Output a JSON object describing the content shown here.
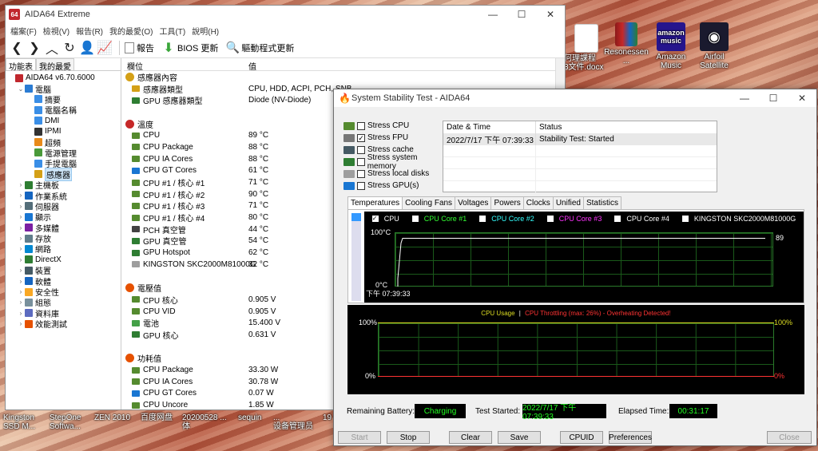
{
  "desktop": {
    "icons": [
      {
        "label": "何理課程\n3文件.docx",
        "color": "#2b579a"
      },
      {
        "label": "Resonessen\n...",
        "color": "#8b1a1a"
      },
      {
        "label": "Amazon\nMusic",
        "color": "#25158d"
      },
      {
        "label": "Airfoil\nSatellite",
        "color": "#1a1a2e"
      }
    ],
    "taskbar_items": [
      "Kingston\nSSD M...",
      "StepOne\nSoftwa...",
      "ZEN 2010",
      "百度网盘",
      "20200528 ...\n体",
      "sequin",
      "...\n设备管理员",
      "19"
    ]
  },
  "aida": {
    "title": "AIDA64 Extreme",
    "logo": "64",
    "menu": [
      "檔案(F)",
      "檢視(V)",
      "報告(R)",
      "我的最愛(O)",
      "工具(T)",
      "說明(H)"
    ],
    "toolbar": {
      "report": "報告",
      "bios": "BIOS 更新",
      "driver": "驅動程式更新"
    },
    "tabs": [
      "功能表",
      "我的最愛"
    ],
    "tree": [
      {
        "label": "AIDA64 v6.70.6000",
        "tog": "",
        "color": "#c0272d",
        "indent": 0
      },
      {
        "label": "電腦",
        "tog": "v",
        "color": "#2b7cd3",
        "indent": 1
      },
      {
        "label": "摘要",
        "tog": "",
        "color": "#3a8ee6",
        "indent": 2
      },
      {
        "label": "電腦名稱",
        "tog": "",
        "color": "#3a8ee6",
        "indent": 2
      },
      {
        "label": "DMI",
        "tog": "",
        "color": "#3a8ee6",
        "indent": 2
      },
      {
        "label": "IPMI",
        "tog": "",
        "color": "#333",
        "indent": 2
      },
      {
        "label": "超頻",
        "tog": "",
        "color": "#e88a1a",
        "indent": 2
      },
      {
        "label": "電源管理",
        "tog": "",
        "color": "#4a9a3a",
        "indent": 2
      },
      {
        "label": "手提電腦",
        "tog": "",
        "color": "#3a8ee6",
        "indent": 2
      },
      {
        "label": "感應器",
        "tog": "",
        "color": "#d4a017",
        "indent": 2,
        "selected": true
      },
      {
        "label": "主機板",
        "tog": ">",
        "color": "#2e7d32",
        "indent": 1
      },
      {
        "label": "作業系統",
        "tog": ">",
        "color": "#1565c0",
        "indent": 1
      },
      {
        "label": "伺服器",
        "tog": ">",
        "color": "#546e7a",
        "indent": 1
      },
      {
        "label": "顯示",
        "tog": ">",
        "color": "#1976d2",
        "indent": 1
      },
      {
        "label": "多媒體",
        "tog": ">",
        "color": "#7b1fa2",
        "indent": 1
      },
      {
        "label": "存放",
        "tog": ">",
        "color": "#607d8b",
        "indent": 1
      },
      {
        "label": "網路",
        "tog": ">",
        "color": "#0288d1",
        "indent": 1
      },
      {
        "label": "DirectX",
        "tog": ">",
        "color": "#2e7d32",
        "indent": 1
      },
      {
        "label": "裝置",
        "tog": ">",
        "color": "#455a64",
        "indent": 1
      },
      {
        "label": "軟體",
        "tog": ">",
        "color": "#1565c0",
        "indent": 1
      },
      {
        "label": "安全性",
        "tog": ">",
        "color": "#f9a825",
        "indent": 1
      },
      {
        "label": "組態",
        "tog": ">",
        "color": "#78909c",
        "indent": 1
      },
      {
        "label": "資料庫",
        "tog": ">",
        "color": "#5c6bc0",
        "indent": 1
      },
      {
        "label": "效能測試",
        "tog": ">",
        "color": "#e65100",
        "indent": 1
      }
    ],
    "columns": [
      "欄位",
      "值"
    ],
    "rows": [
      {
        "field": "感應器內容",
        "value": "",
        "group": true,
        "color": "#d4a017"
      },
      {
        "field": "感應器類型",
        "value": "CPU, HDD, ACPI, PCH, SNB",
        "color": "#d4a017"
      },
      {
        "field": "GPU 感應器類型",
        "value": "Diode  (NV-Diode)",
        "color": "#2e7d32"
      },
      {
        "field": "",
        "value": "",
        "spacer": true
      },
      {
        "field": "溫度",
        "value": "",
        "group": true,
        "color": "#c62828"
      },
      {
        "field": "CPU",
        "value": "89 °C",
        "color": "#558b2f"
      },
      {
        "field": "CPU Package",
        "value": "88 °C",
        "color": "#558b2f"
      },
      {
        "field": "CPU IA Cores",
        "value": "88 °C",
        "color": "#558b2f"
      },
      {
        "field": "CPU GT Cores",
        "value": "61 °C",
        "color": "#1976d2"
      },
      {
        "field": "CPU #1 / 核心 #1",
        "value": "71 °C",
        "color": "#558b2f"
      },
      {
        "field": "CPU #1 / 核心 #2",
        "value": "90 °C",
        "color": "#558b2f"
      },
      {
        "field": "CPU #1 / 核心 #3",
        "value": "71 °C",
        "color": "#558b2f"
      },
      {
        "field": "CPU #1 / 核心 #4",
        "value": "80 °C",
        "color": "#558b2f"
      },
      {
        "field": "PCH 真空管",
        "value": "44 °C",
        "color": "#424242"
      },
      {
        "field": "GPU 真空管",
        "value": "54 °C",
        "color": "#2e7d32"
      },
      {
        "field": "GPU Hotspot",
        "value": "62 °C",
        "color": "#2e7d32"
      },
      {
        "field": "KINGSTON SKC2000M81000G",
        "value": "32 °C",
        "color": "#9e9e9e"
      },
      {
        "field": "",
        "value": "",
        "spacer": true
      },
      {
        "field": "電壓值",
        "value": "",
        "group": true,
        "color": "#e65100"
      },
      {
        "field": "CPU 核心",
        "value": "0.905 V",
        "color": "#558b2f"
      },
      {
        "field": "CPU VID",
        "value": "0.905 V",
        "color": "#558b2f"
      },
      {
        "field": "電池",
        "value": "15.400 V",
        "color": "#43a047"
      },
      {
        "field": "GPU 核心",
        "value": "0.631 V",
        "color": "#2e7d32"
      },
      {
        "field": "",
        "value": "",
        "spacer": true
      },
      {
        "field": "功耗值",
        "value": "",
        "group": true,
        "color": "#e65100"
      },
      {
        "field": "CPU Package",
        "value": "33.30 W",
        "color": "#558b2f"
      },
      {
        "field": "CPU IA Cores",
        "value": "30.78 W",
        "color": "#558b2f"
      },
      {
        "field": "CPU GT Cores",
        "value": "0.07 W",
        "color": "#1976d2"
      },
      {
        "field": "CPU Uncore",
        "value": "1.85 W",
        "color": "#558b2f"
      }
    ]
  },
  "sst": {
    "title": "System Stability Test - AIDA64",
    "stress": [
      {
        "label": "Stress CPU",
        "checked": false,
        "color": "#558b2f"
      },
      {
        "label": "Stress FPU",
        "checked": true,
        "color": "#777"
      },
      {
        "label": "Stress cache",
        "checked": false,
        "color": "#455a64"
      },
      {
        "label": "Stress system memory",
        "checked": false,
        "color": "#2e7d32"
      },
      {
        "label": "Stress local disks",
        "checked": false,
        "color": "#9e9e9e"
      },
      {
        "label": "Stress GPU(s)",
        "checked": false,
        "color": "#1976d2"
      }
    ],
    "log_head": [
      "Date & Time",
      "Status"
    ],
    "log_rows": [
      {
        "time": "2022/7/17 下午 07:39:33",
        "status": "Stability Test: Started"
      }
    ],
    "tabs": [
      "Temperatures",
      "Cooling Fans",
      "Voltages",
      "Powers",
      "Clocks",
      "Unified",
      "Statistics"
    ],
    "temp_graph": {
      "checks": [
        {
          "label": "CPU",
          "color": "#ffffff",
          "checked": true
        },
        {
          "label": "CPU Core #1",
          "color": "#33ff33",
          "checked": false
        },
        {
          "label": "CPU Core #2",
          "color": "#33ffff",
          "checked": false
        },
        {
          "label": "CPU Core #3",
          "color": "#ff33ff",
          "checked": false
        },
        {
          "label": "CPU Core #4",
          "color": "#ffffff",
          "checked": false
        },
        {
          "label": "KINGSTON SKC2000M81000G",
          "color": "#ffffff",
          "checked": false
        }
      ],
      "top_label": "100°C",
      "bottom_label": "0°C",
      "time_label": "下午 07:39:33",
      "current": "89"
    },
    "usage_graph": {
      "title_a": "CPU Usage",
      "sep": "|",
      "title_b": "CPU Throttling (max: 26%) - Overheating Detected!",
      "left_top": "100%",
      "left_bottom": "0%",
      "right_top": "100%",
      "right_bottom": "0%"
    },
    "status": {
      "battery_label": "Remaining Battery:",
      "battery": "Charging",
      "started_label": "Test Started:",
      "started": "2022/7/17 下午 07:39:33",
      "elapsed_label": "Elapsed Time:",
      "elapsed": "00:31:17"
    },
    "buttons": {
      "start": "Start",
      "stop": "Stop",
      "clear": "Clear",
      "save": "Save",
      "cpuid": "CPUID",
      "prefs": "Preferences",
      "close": "Close"
    }
  },
  "chart_data": [
    {
      "type": "line",
      "title": "",
      "series": [
        {
          "name": "CPU",
          "x": [
            "下午 07:39:33"
          ],
          "values": [
            89
          ]
        }
      ],
      "ylim": [
        0,
        100
      ],
      "ylabel": "°C"
    },
    {
      "type": "line",
      "title": "CPU Usage | CPU Throttling (max: 26%) - Overheating Detected!",
      "series": [
        {
          "name": "CPU Usage",
          "values": [
            100
          ]
        },
        {
          "name": "CPU Throttling",
          "values": [
            0
          ]
        }
      ],
      "ylim": [
        0,
        100
      ]
    }
  ]
}
